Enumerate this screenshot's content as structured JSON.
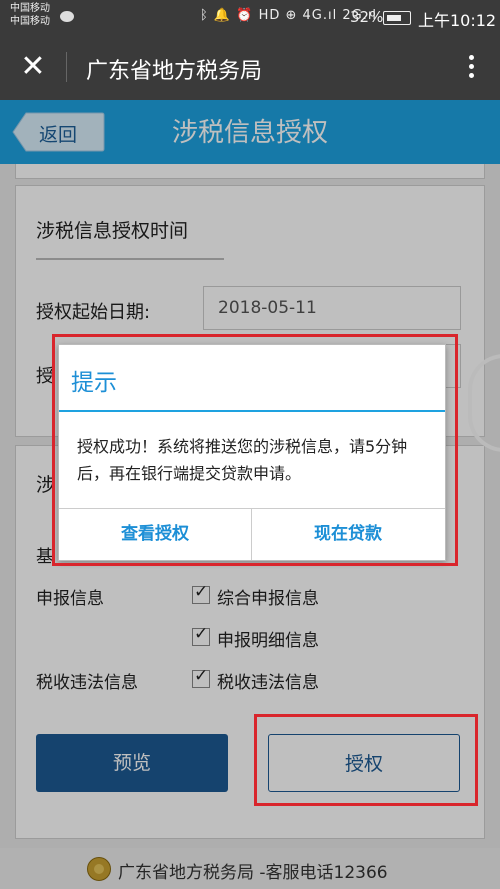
{
  "status_bar": {
    "carrier_1": "中国移动",
    "carrier_2": "中国移动",
    "icons": "ᛒ 🔔 ⏰ HD ⊕ 4G.ıl 2G.ıl",
    "battery": "32%",
    "time": "上午10:12"
  },
  "titlebar": {
    "title": "广东省地方税务局"
  },
  "page": {
    "back_label": "返回",
    "title": "涉税信息授权"
  },
  "auth_time": {
    "section_title": "涉税信息授权时间",
    "start_label": "授权起始日期:",
    "start_value": "2018-05-11",
    "end_label_partial": "授"
  },
  "auth_scope": {
    "section_title_partial": "涉",
    "row1_label_partial": "基",
    "rows": [
      {
        "label": "申报信息",
        "options": [
          "综合申报信息",
          "申报明细信息"
        ]
      },
      {
        "label": "税收违法信息",
        "options": [
          "税收违法信息"
        ]
      }
    ]
  },
  "buttons": {
    "preview": "预览",
    "authorize": "授权"
  },
  "footer": {
    "text": "广东省地方税务局 -客服电话12366"
  },
  "dialog": {
    "title": "提示",
    "message": "授权成功！系统将推送您的涉税信息，请5分钟后，再在银行端提交贷款申请。",
    "btn_view": "查看授权",
    "btn_loan": "现在贷款"
  },
  "colors": {
    "header_blue": "#1ea2e0",
    "dark_blue": "#1d5a93",
    "highlight_red": "#d9252c"
  }
}
